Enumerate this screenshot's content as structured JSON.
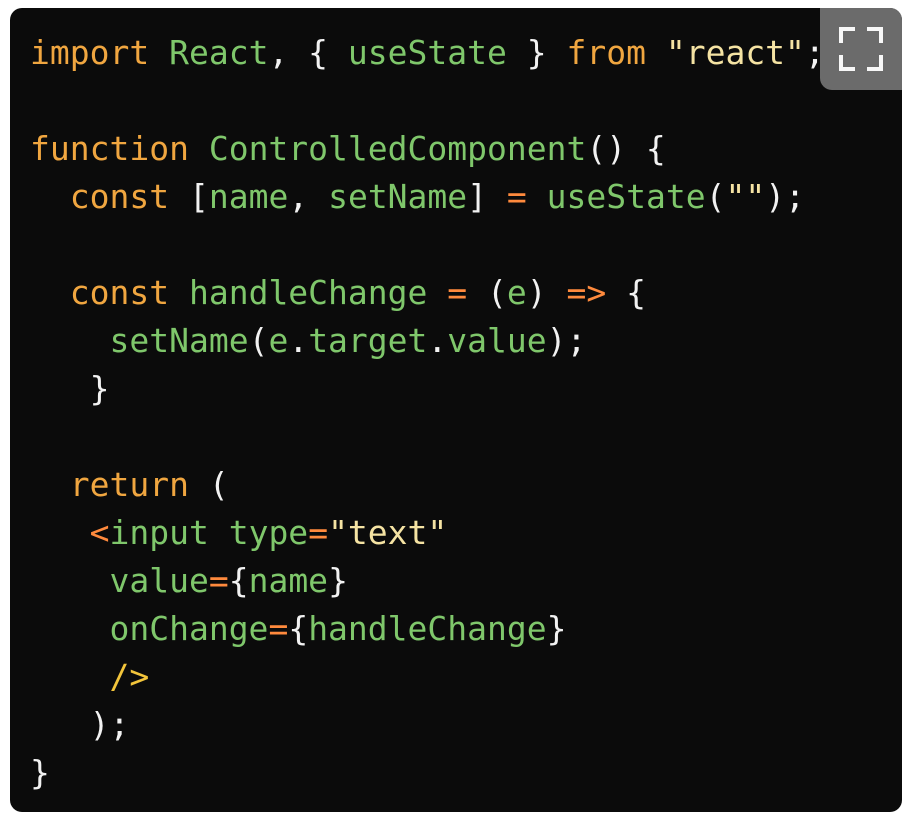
{
  "code": {
    "language": "jsx",
    "lines": [
      [
        {
          "t": "import",
          "c": "kw"
        },
        {
          "t": " ",
          "c": "plain"
        },
        {
          "t": "React",
          "c": "fn"
        },
        {
          "t": ", { ",
          "c": "plain"
        },
        {
          "t": "useState",
          "c": "fn"
        },
        {
          "t": " } ",
          "c": "plain"
        },
        {
          "t": "from",
          "c": "kw"
        },
        {
          "t": " ",
          "c": "plain"
        },
        {
          "t": "\"react\"",
          "c": "str"
        },
        {
          "t": ";",
          "c": "plain"
        }
      ],
      [],
      [
        {
          "t": "function",
          "c": "kw"
        },
        {
          "t": " ",
          "c": "plain"
        },
        {
          "t": "ControlledComponent",
          "c": "fn"
        },
        {
          "t": "() {",
          "c": "plain"
        }
      ],
      [
        {
          "t": "  ",
          "c": "plain"
        },
        {
          "t": "const",
          "c": "kw"
        },
        {
          "t": " [",
          "c": "plain"
        },
        {
          "t": "name",
          "c": "fn"
        },
        {
          "t": ", ",
          "c": "plain"
        },
        {
          "t": "setName",
          "c": "fn"
        },
        {
          "t": "] ",
          "c": "plain"
        },
        {
          "t": "=",
          "c": "op"
        },
        {
          "t": " ",
          "c": "plain"
        },
        {
          "t": "useState",
          "c": "fn"
        },
        {
          "t": "(",
          "c": "plain"
        },
        {
          "t": "\"\"",
          "c": "str"
        },
        {
          "t": ");",
          "c": "plain"
        }
      ],
      [],
      [
        {
          "t": "  ",
          "c": "plain"
        },
        {
          "t": "const",
          "c": "kw"
        },
        {
          "t": " ",
          "c": "plain"
        },
        {
          "t": "handleChange",
          "c": "fn"
        },
        {
          "t": " ",
          "c": "plain"
        },
        {
          "t": "=",
          "c": "op"
        },
        {
          "t": " (",
          "c": "plain"
        },
        {
          "t": "e",
          "c": "fn"
        },
        {
          "t": ") ",
          "c": "plain"
        },
        {
          "t": "=>",
          "c": "op"
        },
        {
          "t": " {",
          "c": "plain"
        }
      ],
      [
        {
          "t": "    ",
          "c": "plain"
        },
        {
          "t": "setName",
          "c": "fn"
        },
        {
          "t": "(",
          "c": "plain"
        },
        {
          "t": "e",
          "c": "fn"
        },
        {
          "t": ".",
          "c": "plain"
        },
        {
          "t": "target",
          "c": "fn"
        },
        {
          "t": ".",
          "c": "plain"
        },
        {
          "t": "value",
          "c": "fn"
        },
        {
          "t": ");",
          "c": "plain"
        }
      ],
      [
        {
          "t": "   }",
          "c": "plain"
        }
      ],
      [],
      [
        {
          "t": "  ",
          "c": "plain"
        },
        {
          "t": "return",
          "c": "kw"
        },
        {
          "t": " (",
          "c": "plain"
        }
      ],
      [
        {
          "t": "   ",
          "c": "plain"
        },
        {
          "t": "<",
          "c": "tag"
        },
        {
          "t": "input",
          "c": "fn"
        },
        {
          "t": " ",
          "c": "plain"
        },
        {
          "t": "type",
          "c": "fn"
        },
        {
          "t": "=",
          "c": "op"
        },
        {
          "t": "\"text\"",
          "c": "str"
        }
      ],
      [
        {
          "t": "    ",
          "c": "plain"
        },
        {
          "t": "value",
          "c": "fn"
        },
        {
          "t": "=",
          "c": "op"
        },
        {
          "t": "{",
          "c": "plain"
        },
        {
          "t": "name",
          "c": "fn"
        },
        {
          "t": "}",
          "c": "plain"
        }
      ],
      [
        {
          "t": "    ",
          "c": "plain"
        },
        {
          "t": "onChange",
          "c": "fn"
        },
        {
          "t": "=",
          "c": "op"
        },
        {
          "t": "{",
          "c": "plain"
        },
        {
          "t": "handleChange",
          "c": "fn"
        },
        {
          "t": "}",
          "c": "plain"
        }
      ],
      [
        {
          "t": "    ",
          "c": "plain"
        },
        {
          "t": "/>",
          "c": "selfclose"
        }
      ],
      [
        {
          "t": "   );",
          "c": "plain"
        }
      ],
      [
        {
          "t": "}",
          "c": "plain"
        }
      ]
    ]
  },
  "expand_button": {
    "icon": "fullscreen-icon"
  },
  "colors": {
    "background": "#0b0b0b",
    "keyword": "#f0a640",
    "identifier": "#7fc76b",
    "string": "#f5e3a3",
    "operator": "#ff8a3d",
    "plain": "#f2f2f2",
    "button": "#6b6b6b"
  }
}
